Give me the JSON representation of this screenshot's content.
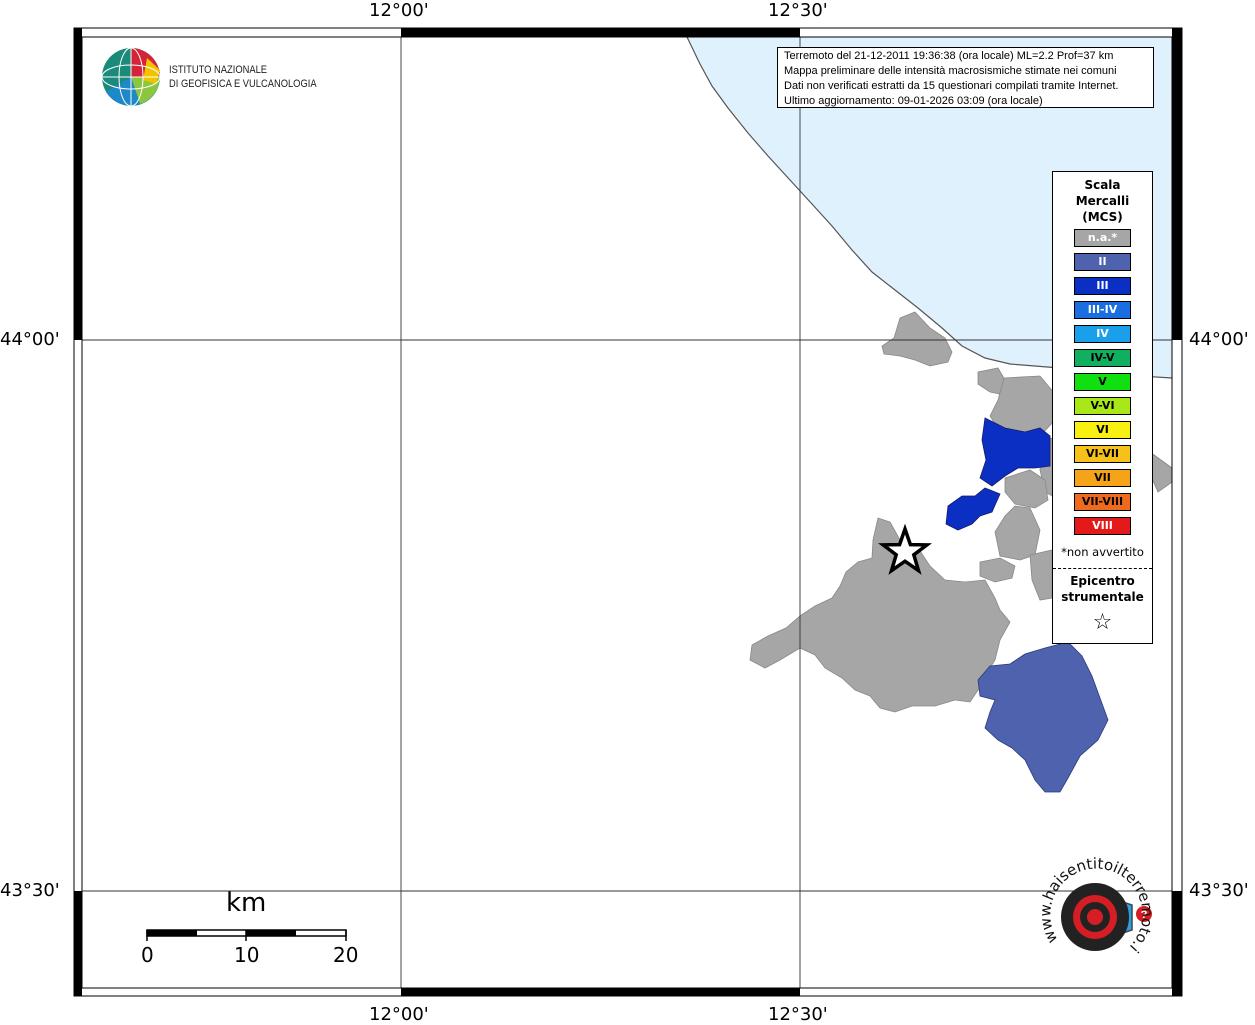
{
  "institute": {
    "line1": "ISTITUTO NAZIONALE",
    "line2": "DI GEOFISICA E VULCANOLOGIA",
    "logo_icon": "ingv-globe-icon"
  },
  "info": {
    "line1": "Terremoto del 21-12-2011 19:36:38 (ora locale) ML=2.2 Prof=37 km",
    "line2": "Mappa preliminare delle intensità macrosismiche stimate nei comuni",
    "line3": "Dati non verificati estratti da 15 questionari compilati tramite Internet.",
    "line4": "Ultimo aggiornamento: 09-01-2026 03:09 (ora locale)"
  },
  "axes": {
    "top": [
      "12°00'",
      "12°30'"
    ],
    "bottom": [
      "12°00'",
      "12°30'"
    ],
    "left": [
      "44°00'",
      "43°30'"
    ],
    "right": [
      "44°00'",
      "43°30'"
    ]
  },
  "legend": {
    "title_lines": [
      "Scala",
      "Mercalli",
      "(MCS)"
    ],
    "items": [
      {
        "label": "n.a.*",
        "color": "#a6a6a6"
      },
      {
        "label": "II",
        "color": "#4f62ae"
      },
      {
        "label": "III",
        "color": "#0a2fc2"
      },
      {
        "label": "III-IV",
        "color": "#1a6ee0"
      },
      {
        "label": "IV",
        "color": "#1aa0ea"
      },
      {
        "label": "IV-V",
        "color": "#10b060"
      },
      {
        "label": "V",
        "color": "#10e010"
      },
      {
        "label": "V-VI",
        "color": "#a8e818"
      },
      {
        "label": "VI",
        "color": "#f7f010"
      },
      {
        "label": "VI-VII",
        "color": "#f6c21a"
      },
      {
        "label": "VII",
        "color": "#f5a318"
      },
      {
        "label": "VII-VIII",
        "color": "#f06a1e"
      },
      {
        "label": "VIII",
        "color": "#e41a1a"
      }
    ],
    "note": "*non avvertito",
    "epicenter_lines": [
      "Epicentro",
      "strumentale"
    ],
    "epicenter_icon": "star-icon"
  },
  "scalebar": {
    "unit": "km",
    "ticks": [
      "0",
      "10",
      "20"
    ]
  },
  "map_colors": {
    "sea": "#dff1fd",
    "not_felt": "#a6a6a6",
    "intensity_II": "#4f62ae",
    "intensity_III": "#0a2fc2"
  },
  "watermark": {
    "text": "www.haisentitoilterremoto.it",
    "icon": "haisentito-logo-icon"
  }
}
